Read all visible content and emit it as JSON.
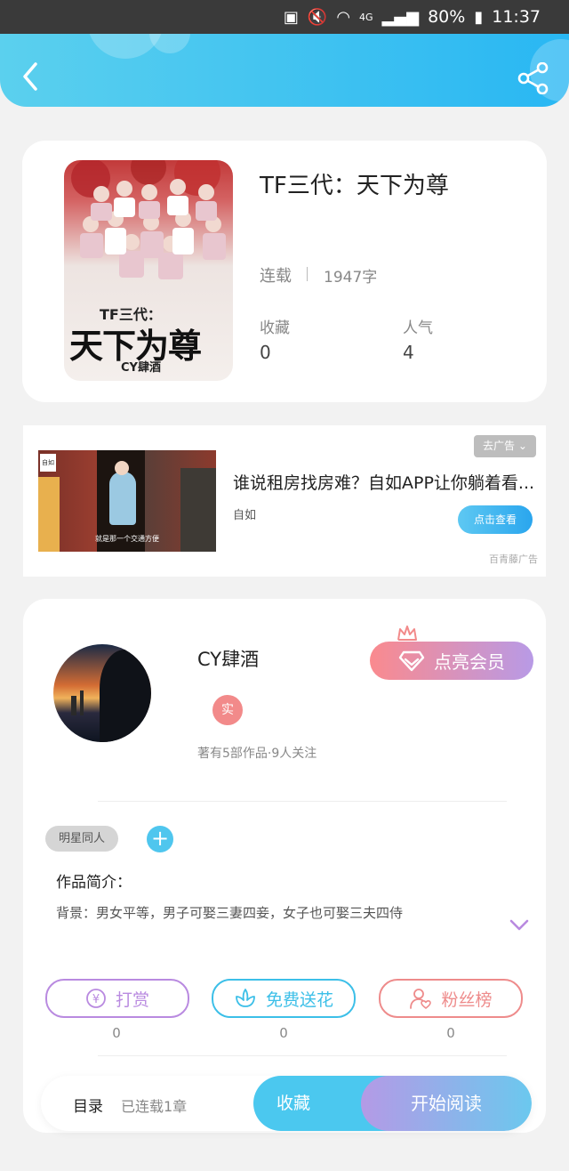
{
  "status_bar": {
    "battery": "80%",
    "time": "11:37",
    "network": "4G"
  },
  "book": {
    "title": "TF三代：天下为尊",
    "status": "连载",
    "word_count": "1947字",
    "favorites_label": "收藏",
    "favorites_value": "0",
    "popularity_label": "人气",
    "popularity_value": "4",
    "cover_title_small": "TF三代：",
    "cover_title_big": "天下为尊",
    "cover_author": "CY肆酒"
  },
  "ad": {
    "close_label": "去广告",
    "title": "谁说租房找房难？自如APP让你躺着看...",
    "brand": "自如",
    "cta": "点击查看",
    "source": "百青藤广告",
    "image_logo": "自如",
    "image_caption": "就是那一个交通方便"
  },
  "author": {
    "name": "CY肆酒",
    "verified_badge": "实",
    "stats": "著有5部作品·9人关注",
    "vip_label": "点亮会员"
  },
  "tags": [
    "明星同人"
  ],
  "intro": {
    "heading": "作品简介：",
    "text": "背景：男女平等，男子可娶三妻四妾，女子也可娶三夫四侍"
  },
  "actions": [
    {
      "label": "打赏",
      "count": "0",
      "color": "#b98ae0"
    },
    {
      "label": "免费送花",
      "count": "0",
      "color": "#3cbfe8"
    },
    {
      "label": "粉丝榜",
      "count": "0",
      "color": "#ee8b8b"
    }
  ],
  "bottom_bar": {
    "toc_label": "目录",
    "chapters": "已连载1章",
    "collect_label": "收藏",
    "read_label": "开始阅读"
  }
}
